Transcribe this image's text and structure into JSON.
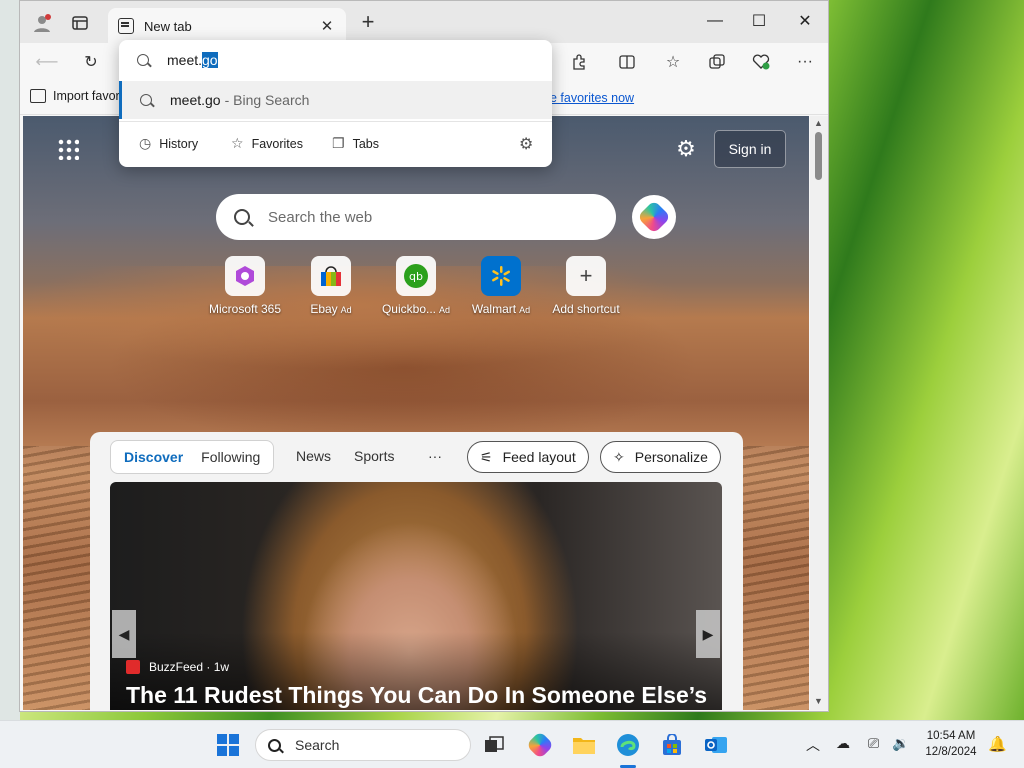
{
  "browser": {
    "tab_title": "New tab",
    "tab_close": "✕",
    "new_tab": "+",
    "window_controls": {
      "minimize": "—",
      "maximize": "☐",
      "close": "✕"
    },
    "favorites_bar": {
      "import_label": "Import favor",
      "link_text": "e favorites now"
    }
  },
  "omnibox": {
    "typed_prefix": "meet.",
    "typed_selected": "go",
    "suggestion": {
      "text": "meet.go",
      "desc": "- Bing Search"
    },
    "chips": [
      {
        "label": "History",
        "icon": "history-icon"
      },
      {
        "label": "Favorites",
        "icon": "star-icon"
      },
      {
        "label": "Tabs",
        "icon": "tabs-icon"
      }
    ]
  },
  "newtab": {
    "signin": "Sign in",
    "search_placeholder": "Search the web",
    "shortcuts": [
      {
        "label": "Microsoft 365",
        "ad": ""
      },
      {
        "label": "Ebay",
        "ad": "Ad"
      },
      {
        "label": "Quickbo...",
        "ad": "Ad"
      },
      {
        "label": "Walmart",
        "ad": "Ad"
      },
      {
        "label": "Add shortcut",
        "ad": ""
      }
    ],
    "feed": {
      "tabs": [
        "Discover",
        "Following"
      ],
      "nav": [
        "News",
        "Sports",
        "···"
      ],
      "feed_layout": "Feed layout",
      "personalize": "Personalize",
      "article": {
        "source": "BuzzFeed · 1w",
        "headline": "The 11 Rudest Things You Can Do In Someone Else’s"
      }
    }
  },
  "taskbar": {
    "search_placeholder": "Search",
    "time": "10:54 AM",
    "date": "12/8/2024"
  },
  "colors": {
    "accent": "#0f6cbd",
    "link": "#0b57d0"
  }
}
